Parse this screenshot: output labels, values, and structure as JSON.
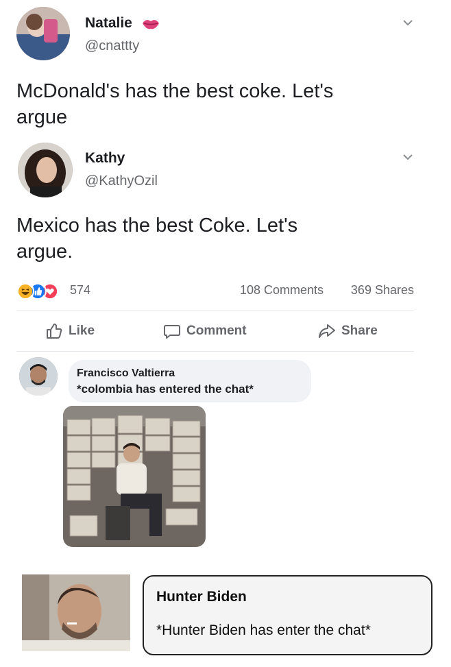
{
  "post1": {
    "author_name": "Natalie",
    "handle": "@cnattty",
    "text_line1": "McDonald's has the best coke. Let's",
    "text_line2": "argue",
    "icons": {
      "badge": "lips-icon",
      "menu": "chevron-down-icon"
    }
  },
  "post2": {
    "author_name": "Kathy",
    "handle": "@KathyOzil",
    "text_line1": "Mexico has the best Coke. Let's",
    "text_line2": "argue.",
    "icons": {
      "menu": "chevron-down-icon"
    }
  },
  "stats": {
    "reaction_count": "574",
    "comments": "108 Comments",
    "shares": "369 Shares",
    "reaction_icons": [
      "haha-icon",
      "like-icon",
      "love-icon"
    ]
  },
  "actions": {
    "like": "Like",
    "comment": "Comment",
    "share": "Share"
  },
  "comment": {
    "author": "Francisco Valtierra",
    "text": "*colombia has entered the chat*"
  },
  "hunter": {
    "name": "Hunter Biden",
    "text": "*Hunter Biden has enter the chat*"
  },
  "colors": {
    "text": "#1c1e21",
    "secondary": "#65676b",
    "bubble": "#f0f2f5",
    "like_blue": "#1877f2",
    "love_red": "#f33e58",
    "haha_yellow": "#f7b125",
    "lips": "#e0407a"
  }
}
